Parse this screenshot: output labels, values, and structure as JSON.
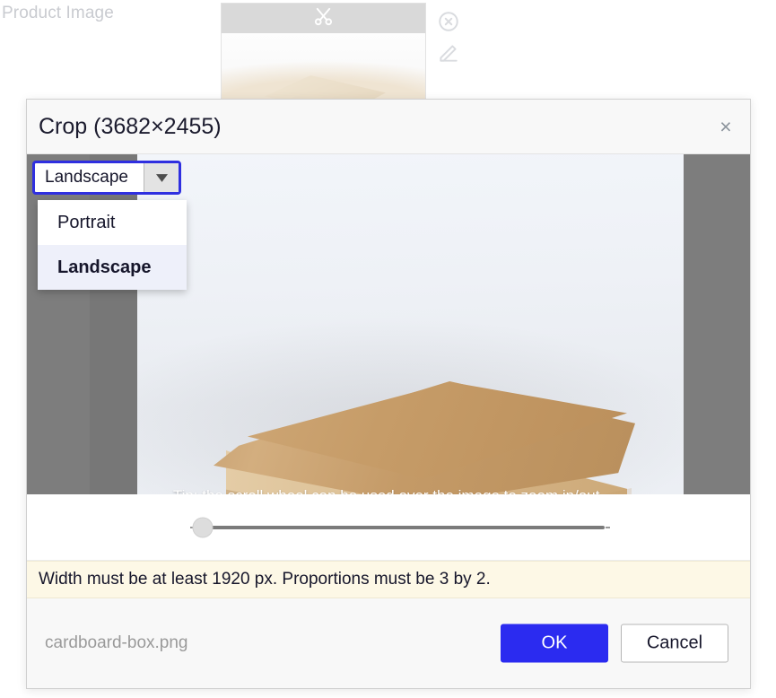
{
  "background": {
    "field_label": "Product Image",
    "thumbnail_toolbar_icon": "scissors-icon",
    "side_icons": [
      "remove-circle-icon",
      "edit-pencil-icon"
    ]
  },
  "dialog": {
    "title": "Crop (3682×2455)",
    "close_label": "×",
    "aspect": {
      "selected": "Landscape",
      "arrow_icon": "chevron-down-icon",
      "options": [
        {
          "label": "Portrait",
          "selected": false
        },
        {
          "label": "Landscape",
          "selected": true
        }
      ]
    },
    "stage": {
      "tip": "Tip: the scroll wheel can be used over the image to zoom in/out.",
      "hint_icon": "mouse-scroll-icon"
    },
    "zoom_slider": {
      "name": "zoom-slider",
      "value_position_percent": 2
    },
    "constraint_message": "Width must be at least 1920 px. Proportions must be 3 by 2.",
    "footer": {
      "file_name": "cardboard-box.png",
      "ok_label": "OK",
      "cancel_label": "Cancel"
    }
  },
  "colors": {
    "accent_blue": "#2b2bf0",
    "focus_ring": "#2f2fe0",
    "mask_gray": "#7d7d7d",
    "warning_bg": "#fdf8e6"
  }
}
